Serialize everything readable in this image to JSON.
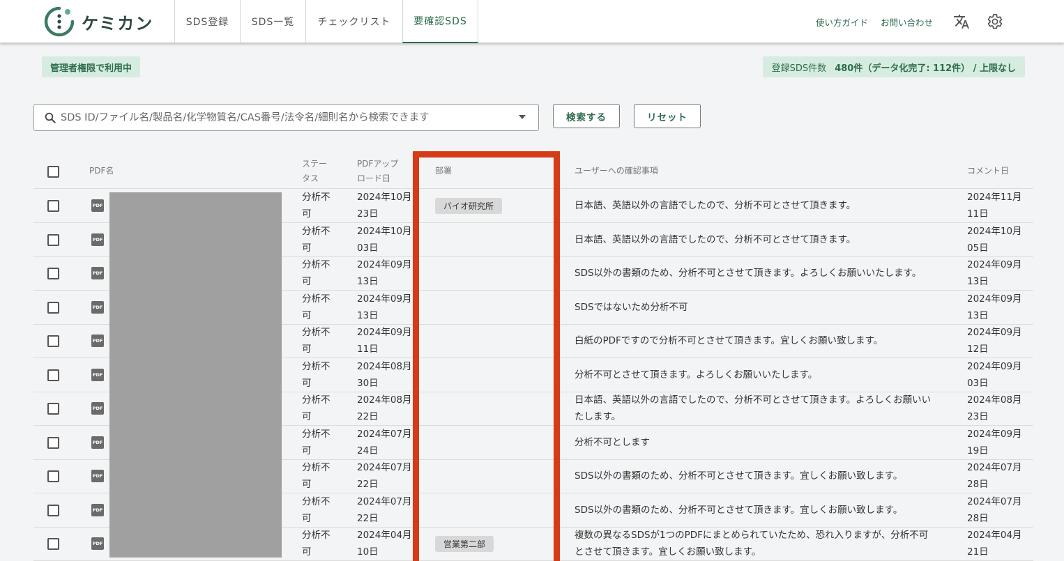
{
  "header": {
    "logo_text": "ケミカン",
    "tabs": [
      {
        "label": "SDS登録"
      },
      {
        "label": "SDS一覧"
      },
      {
        "label": "チェックリスト"
      },
      {
        "label": "要確認SDS"
      }
    ],
    "active_tab": "要確認SDS",
    "links": {
      "guide": "使い方ガイド",
      "contact": "お問い合わせ"
    },
    "icons": [
      "translate-icon",
      "gear-icon"
    ]
  },
  "status": {
    "admin_badge": "管理者権限で利用中",
    "count_label": "登録SDS件数",
    "count_value": "480件（データ化完了: 112件） / 上限なし"
  },
  "search": {
    "placeholder": "SDS ID/ファイル名/製品名/化学物質名/CAS番号/法令名/細則名から検索できます",
    "search_button": "検索する",
    "reset_button": "リセット"
  },
  "table": {
    "headers": {
      "pdf_name": "PDF名",
      "status_line1": "ステー",
      "status_line2": "タス",
      "upload_line1": "PDFアップ",
      "upload_line2": "ロード日",
      "department": "部署",
      "confirm": "ユーザーへの確認事項",
      "comment_date": "コメント日"
    },
    "rows": [
      {
        "status1": "分析不",
        "status2": "可",
        "upload1": "2024年10月",
        "upload2": "23日",
        "dept": "バイオ研究所",
        "confirm1": "日本語、英語以外の言語でしたので、分析不可とさせて頂きます。",
        "confirm2": "",
        "comment1": "2024年11月",
        "comment2": "11日"
      },
      {
        "status1": "分析不",
        "status2": "可",
        "upload1": "2024年10月",
        "upload2": "03日",
        "dept": "",
        "confirm1": "日本語、英語以外の言語でしたので、分析不可とさせて頂きます。",
        "confirm2": "",
        "comment1": "2024年10月",
        "comment2": "05日"
      },
      {
        "status1": "分析不",
        "status2": "可",
        "upload1": "2024年09月",
        "upload2": "13日",
        "dept": "",
        "confirm1": "SDS以外の書類のため、分析不可とさせて頂きます。よろしくお願いいたします。",
        "confirm2": "",
        "comment1": "2024年09月",
        "comment2": "13日"
      },
      {
        "status1": "分析不",
        "status2": "可",
        "upload1": "2024年09月",
        "upload2": "13日",
        "dept": "",
        "confirm1": "SDSではないため分析不可",
        "confirm2": "",
        "comment1": "2024年09月",
        "comment2": "13日"
      },
      {
        "status1": "分析不",
        "status2": "可",
        "upload1": "2024年09月",
        "upload2": "11日",
        "dept": "",
        "confirm1": "白紙のPDFですので分析不可とさせて頂きます。宜しくお願い致します。",
        "confirm2": "",
        "comment1": "2024年09月",
        "comment2": "12日"
      },
      {
        "status1": "分析不",
        "status2": "可",
        "upload1": "2024年08月",
        "upload2": "30日",
        "dept": "",
        "confirm1": "分析不可とさせて頂きます。よろしくお願いいたします。",
        "confirm2": "",
        "comment1": "2024年09月",
        "comment2": "03日"
      },
      {
        "status1": "分析不",
        "status2": "可",
        "upload1": "2024年08月",
        "upload2": "22日",
        "dept": "",
        "confirm1": "日本語、英語以外の言語でしたので、分析不可とさせて頂きます。よろしくお願いい",
        "confirm2": "たします。",
        "comment1": "2024年08月",
        "comment2": "23日"
      },
      {
        "status1": "分析不",
        "status2": "可",
        "upload1": "2024年07月",
        "upload2": "24日",
        "dept": "",
        "confirm1": "分析不可とします",
        "confirm2": "",
        "comment1": "2024年09月",
        "comment2": "19日"
      },
      {
        "status1": "分析不",
        "status2": "可",
        "upload1": "2024年07月",
        "upload2": "22日",
        "dept": "",
        "confirm1": "SDS以外の書類のため、分析不可とさせて頂きます。宜しくお願い致します。",
        "confirm2": "",
        "comment1": "2024年07月",
        "comment2": "28日"
      },
      {
        "status1": "分析不",
        "status2": "可",
        "upload1": "2024年07月",
        "upload2": "22日",
        "dept": "",
        "confirm1": "SDS以外の書類のため、分析不可とさせて頂きます。宜しくお願い致します。",
        "confirm2": "",
        "comment1": "2024年07月",
        "comment2": "28日"
      },
      {
        "status1": "分析不",
        "status2": "可",
        "upload1": "2024年04月",
        "upload2": "10日",
        "dept": "営業第二部",
        "confirm1": "複数の異なるSDSが1つのPDFにまとめられていたため、恐れ入りますが、分析不可",
        "confirm2": "とさせて頂きます。宜しくお願い致します。",
        "comment1": "2024年04月",
        "comment2": "21日"
      }
    ],
    "pdf_icon_label": "PDF"
  },
  "colors": {
    "brand_green": "#2e6b4c",
    "badge_bg": "#d6ece0",
    "highlight_red": "#d63b17"
  }
}
